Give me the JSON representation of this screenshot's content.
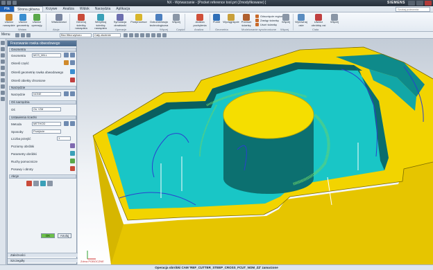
{
  "window": {
    "title": "NX - Wytwarzanie - [Pocket reference tool.prt (Zmodyfikowane) ]",
    "brand": "SIEMENS",
    "search_placeholder": "Szukaj polecenia"
  },
  "menubar": {
    "file": "Plik",
    "tabs": [
      "Strona główna",
      "Krzywe",
      "Analiza",
      "Widok",
      "Narzędzia",
      "Aplikacja"
    ],
    "active_tab": "Strona główna"
  },
  "ribbon": {
    "buttons": [
      {
        "label": "Utwórz narzędzie",
        "icon": "create-tool-icon",
        "color": "#d08a2c"
      },
      {
        "label": "Utwórz geometrię",
        "icon": "create-geometry-icon",
        "color": "#3a8ed0"
      },
      {
        "label": "Utwórz operację",
        "icon": "create-operation-icon",
        "color": "#5aa84a"
      },
      {
        "label": "Właściwości",
        "icon": "properties-icon",
        "color": "#7a86a0"
      },
      {
        "label": "Generuj ścieżkę narzędzia",
        "icon": "generate-toolpath-icon",
        "color": "#c94b3a"
      },
      {
        "label": "Weryfikuj ścieżkę narzędzia",
        "icon": "verify-toolpath-icon",
        "color": "#3aa0b8"
      },
      {
        "label": "Symulacja obrabiarki",
        "icon": "machine-simulation-icon",
        "color": "#6d6fb0"
      },
      {
        "label": "Postprocesor",
        "icon": "postprocess-icon",
        "color": "#d8b62c"
      },
      {
        "label": "Dokumentacja technologiczna",
        "icon": "shop-documentation-icon",
        "color": "#4c7fbf"
      },
      {
        "label": "Więcej",
        "icon": "more-icon",
        "color": "#8a96a6"
      },
      {
        "label": "Analiza pochylenia",
        "icon": "draft-analysis-icon",
        "color": "#d0503a"
      },
      {
        "label": "Punkt",
        "icon": "point-icon",
        "color": "#2f6fb8"
      },
      {
        "label": "Wyciągnięcie",
        "icon": "extrude-icon",
        "color": "#c9a03a"
      },
      {
        "label": "Przesuń ściankę",
        "icon": "move-face-icon",
        "color": "#b0602f"
      },
      {
        "label": "Więcej",
        "icon": "more-icon",
        "color": "#8a96a6"
      },
      {
        "label": "Wyrównaj osie",
        "icon": "align-axes-icon",
        "color": "#5a8cc0"
      },
      {
        "label": "Utwórz obróbkę osi",
        "icon": "orient-wcs-icon",
        "color": "#c04040"
      },
      {
        "label": "Więcej",
        "icon": "more-icon",
        "color": "#8a96a6"
      }
    ],
    "small_buttons": [
      "Odsunięcie regionu",
      "Zastąp ściankę",
      "Usuń ściankę"
    ],
    "groups": [
      "Wstaw",
      "Akcje",
      "Operacje",
      "Więcej",
      "Części",
      "Analiza",
      "Geometria",
      "Modelowanie synchroniczne",
      "Więcej",
      "Ciała"
    ]
  },
  "toolbar2": {
    "menu": "Menu",
    "filter": "Bez filtra wyboru",
    "scope": "Cały złożenie"
  },
  "dialog": {
    "title": "Frezowanie rowka obwodowego",
    "sections": {
      "geometry": "Geometria",
      "tool": "Narzędzie",
      "tool_axis": "Oś narzędzia",
      "path_settings": "Ustawienia ścieżki",
      "actions": "Akcje"
    },
    "geometry_label": "Geometria",
    "geometry_value": "MCS_MILL",
    "specify_part": "Określ część",
    "specify_floor": "Określ geometrię rowka obwodowego",
    "specify_check": "Określ obiekty chronione",
    "tool_label": "Narzędzie",
    "tool_value": "NONE",
    "axis_label": "Oś",
    "axis_value": "Oś +ZM",
    "method_label": "Metoda",
    "method_value": "METHOD",
    "pattern_label": "Sposoby",
    "pattern_value": "Przejście",
    "passes_label": "Liczba przejść",
    "passes_value": "1",
    "cut_levels": "Poziomy obróbki",
    "cut_params": "Parametry obróbki",
    "non_cut_moves": "Ruchy pomocnicze",
    "feeds_speeds": "Posuwy i obroty",
    "ok": "OK",
    "cancel": "Anuluj",
    "details": "Zależności",
    "more": "Szczegóły"
  },
  "viewport": {
    "wcs_label": "Zdrva POBOCZNE"
  },
  "status": "Operacja obróbki CAM 'REF_CUTTER_STEEP_CROSS_FCUT_NOM_ZZ' zamarzone"
}
